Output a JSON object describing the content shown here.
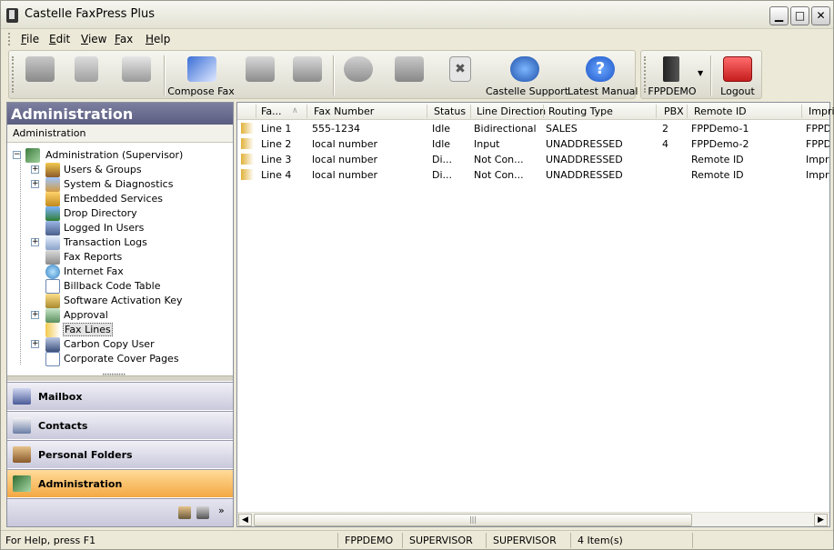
{
  "window": {
    "title": "Castelle FaxPress Plus"
  },
  "menu": [
    "File",
    "Edit",
    "View",
    "Fax",
    "Help"
  ],
  "toolbar": {
    "compose_fax": "Compose Fax",
    "castelle_support": "Castelle Support",
    "latest_manual": "Latest Manual",
    "server": "FPPDEMO",
    "logout": "Logout"
  },
  "left_panel": {
    "header": "Administration",
    "subheader": "Administration",
    "tree_root": "Administration (Supervisor)",
    "tree_items": [
      "Users & Groups",
      "System & Diagnostics",
      "Embedded Services",
      "Drop Directory",
      "Logged In Users",
      "Transaction Logs",
      "Fax Reports",
      "Internet Fax",
      "Billback Code Table",
      "Software Activation Key",
      "Approval",
      "Fax Lines",
      "Carbon Copy User",
      "Corporate Cover Pages"
    ],
    "nav": [
      "Mailbox",
      "Contacts",
      "Personal Folders",
      "Administration"
    ]
  },
  "list": {
    "columns": [
      "Fa...",
      "Fax Number",
      "Status",
      "Line Direction",
      "Routing Type",
      "PBX",
      "Remote ID",
      "Impri"
    ],
    "rows": [
      [
        "Line 1",
        "555-1234",
        "Idle",
        "Bidirectional",
        "SALES",
        "2",
        "FPPDemo-1",
        "FPPDe"
      ],
      [
        "Line 2",
        "local number",
        "Idle",
        "Input",
        "UNADDRESSED",
        "4",
        "FPPDemo-2",
        "FPPDe"
      ],
      [
        "Line 3",
        "local number",
        "Di...",
        "Not Con...",
        "UNADDRESSED",
        "",
        "Remote ID",
        "Imprir"
      ],
      [
        "Line 4",
        "local number",
        "Di...",
        "Not Con...",
        "UNADDRESSED",
        "",
        "Remote ID",
        "Imprir"
      ]
    ]
  },
  "status_bar": {
    "help": "For Help, press F1",
    "server": "FPPDEMO",
    "user": "SUPERVISOR",
    "role": "SUPERVISOR",
    "count": "4 Item(s)"
  }
}
